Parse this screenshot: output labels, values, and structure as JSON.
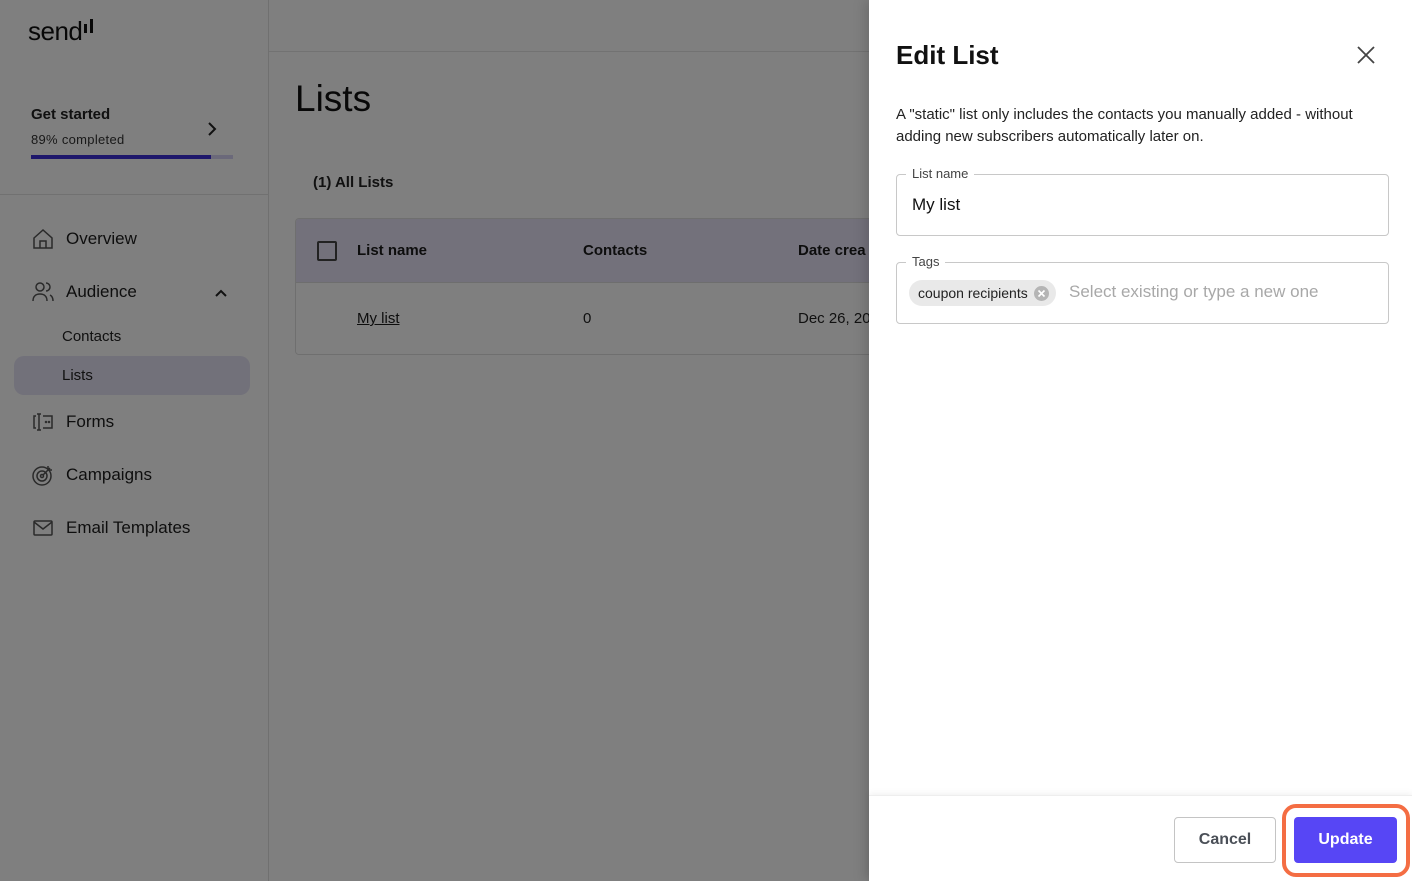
{
  "app": {
    "logo": "send",
    "get_started": {
      "title": "Get started",
      "progress_text": "89% completed",
      "progress_percent": 89
    },
    "nav": {
      "overview": "Overview",
      "audience": "Audience",
      "audience_subs": [
        "Contacts",
        "Lists"
      ],
      "active_sub": "Lists",
      "forms": "Forms",
      "campaigns": "Campaigns",
      "email_templates": "Email Templates"
    }
  },
  "main": {
    "title": "Lists",
    "tab": "(1) All Lists",
    "table": {
      "headers": [
        "List name",
        "Contacts",
        "Date crea"
      ],
      "rows": [
        {
          "name": "My list",
          "contacts": "0",
          "date": "Dec 26, 20"
        }
      ]
    }
  },
  "drawer": {
    "title": "Edit List",
    "description": "A \"static\" list only includes the contacts you manually added - without adding new subscribers automatically later on.",
    "list_name": {
      "label": "List name",
      "value": "My list"
    },
    "tags": {
      "label": "Tags",
      "chips": [
        "coupon recipients"
      ],
      "placeholder": "Select existing or type a new one"
    },
    "cancel_label": "Cancel",
    "update_label": "Update"
  },
  "colors": {
    "accent": "#5746f5",
    "highlight": "#f46d43",
    "progress": "#3d2fd6"
  }
}
